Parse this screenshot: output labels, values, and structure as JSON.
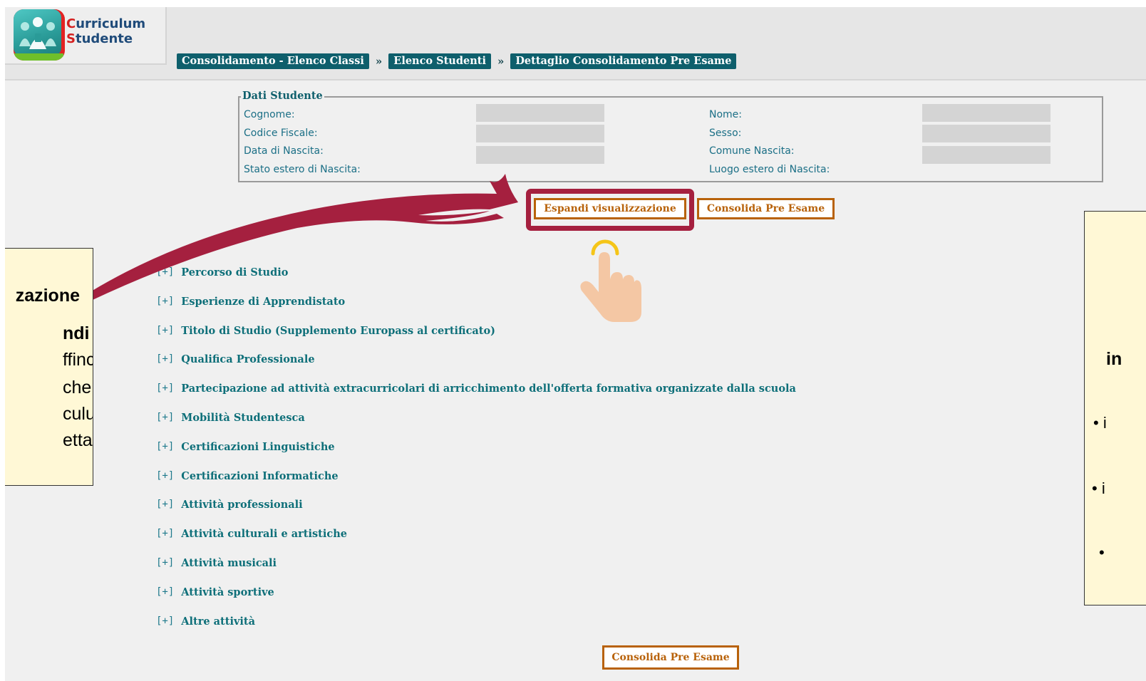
{
  "app": {
    "logo_line1": "Curriculum",
    "logo_line2": "Studente"
  },
  "breadcrumb": {
    "items": [
      "Consolidamento - Elenco Classi",
      "Elenco Studenti",
      "Dettaglio Consolidamento Pre Esame"
    ],
    "separator": "»"
  },
  "dati_studente": {
    "legend": "Dati Studente",
    "cognome_label": "Cognome:",
    "codice_fiscale_label": "Codice Fiscale:",
    "data_nascita_label": "Data di Nascita:",
    "stato_estero_label": "Stato estero di Nascita:",
    "nome_label": "Nome:",
    "sesso_label": "Sesso:",
    "comune_nascita_label": "Comune Nascita:",
    "luogo_estero_label": "Luogo estero di Nascita:"
  },
  "actions": {
    "espandi": "Espandi visualizzazione",
    "consolida_top": "Consolida Pre Esame",
    "consolida_bottom": "Consolida Pre Esame"
  },
  "sections": {
    "toggle": "[+]",
    "items": [
      "Percorso di Studio",
      "Esperienze di Apprendistato",
      "Titolo di Studio (Supplemento Europass al certificato)",
      "Qualifica Professionale",
      "Partecipazione ad attività extracurricolari di arricchimento dell'offerta formativa organizzate dalla scuola",
      "Mobilità Studentesca",
      "Certificazioni Linguistiche",
      "Certificazioni Informatiche",
      "Attività professionali",
      "Attività culturali e artistiche",
      "Attività musicali",
      "Attività sportive",
      "Altre attività"
    ]
  },
  "callout_left": {
    "line1": "zazione",
    "line2": "ndi",
    "line3": "ffinché,",
    "line4": "che",
    "line5": "culum,",
    "line6": "ettaglio"
  },
  "callout_right": {
    "line1": "in",
    "bullet1": "•  i",
    "bullet2": "•  i",
    "bullet3": "•"
  },
  "colors": {
    "accent_teal": "#0e5f6c",
    "button_orange": "#b8620a",
    "highlight_maroon": "#a5203f",
    "callout_bg": "#fff8d6"
  },
  "icons": [
    "logo-icon",
    "tap-hand-icon",
    "annotation-arrow-icon"
  ]
}
